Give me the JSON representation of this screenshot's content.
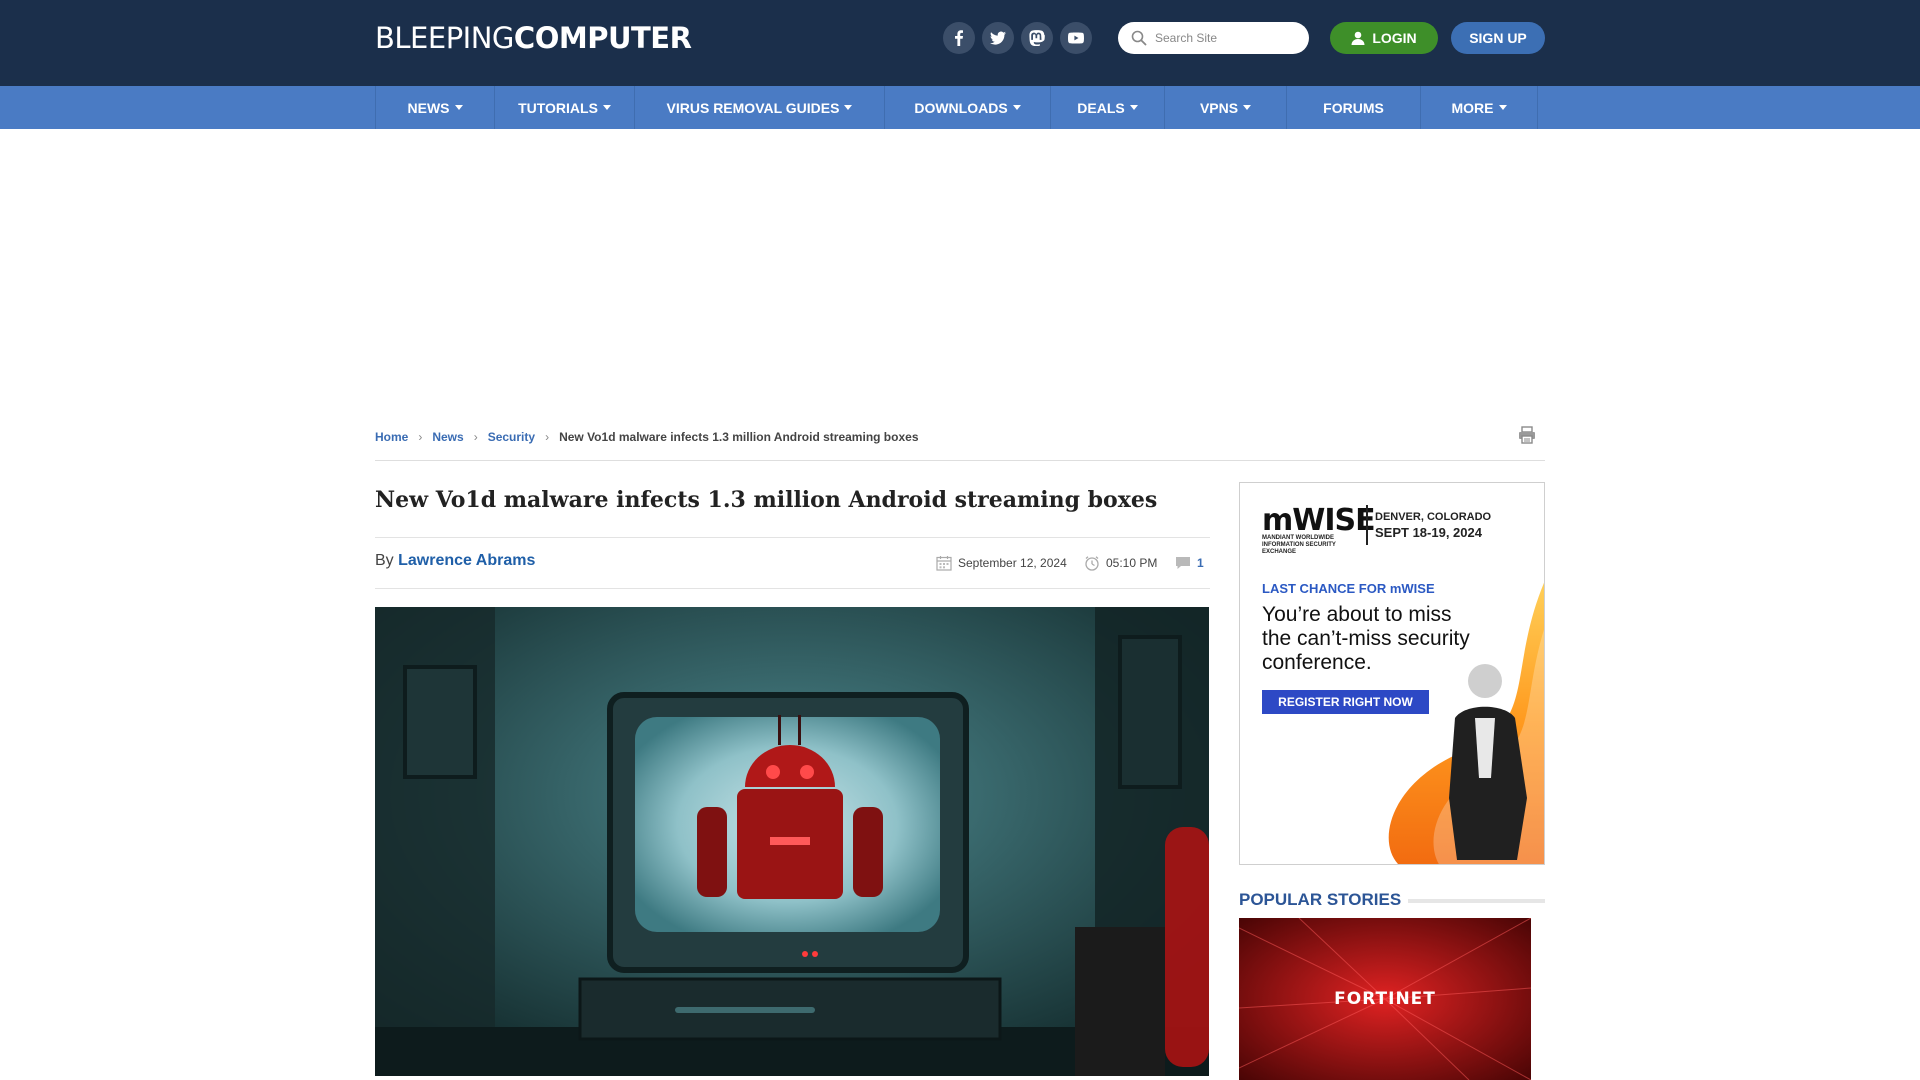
{
  "header": {
    "logo_light": "BLEEPING",
    "logo_bold": "COMPUTER",
    "social": [
      "facebook-icon",
      "twitter-icon",
      "mastodon-icon",
      "youtube-icon"
    ],
    "search_placeholder": "Search Site",
    "login_label": "LOGIN",
    "signup_label": "SIGN UP"
  },
  "nav": {
    "items": [
      {
        "label": "NEWS",
        "dropdown": true
      },
      {
        "label": "TUTORIALS",
        "dropdown": true
      },
      {
        "label": "VIRUS REMOVAL GUIDES",
        "dropdown": true
      },
      {
        "label": "DOWNLOADS",
        "dropdown": true
      },
      {
        "label": "DEALS",
        "dropdown": true
      },
      {
        "label": "VPNS",
        "dropdown": true
      },
      {
        "label": "FORUMS",
        "dropdown": false
      },
      {
        "label": "MORE",
        "dropdown": true
      }
    ]
  },
  "breadcrumb": {
    "items": [
      "Home",
      "News",
      "Security"
    ],
    "current": "New Vo1d malware infects 1.3 million Android streaming boxes"
  },
  "article": {
    "title": "New Vo1d malware infects 1.3 million Android streaming boxes",
    "by_prefix": "By",
    "author": "Lawrence Abrams",
    "date": "September 12, 2024",
    "time": "05:10 PM",
    "comments": "1"
  },
  "sidebar": {
    "ad": {
      "brand": "mWISE",
      "brand_sub": "MANDIANT WORLDWIDE INFORMATION SECURITY EXCHANGE",
      "location_line1": "DENVER, COLORADO",
      "location_line2": "SEPT 18-19, 2024",
      "kicker": "LAST CHANCE FOR mWISE",
      "headline": "You’re about to miss the can’t-miss security conference.",
      "button": "REGISTER RIGHT NOW"
    },
    "popular_title": "POPULAR STORIES",
    "popular_image_brand": "FORTINET"
  },
  "colors": {
    "header_bg": "#1b2f4b",
    "nav_bg": "#4a7bc4",
    "login_green": "#3e8f29",
    "signup_blue": "#3c6fb4",
    "link_blue": "#3a6cb3"
  }
}
